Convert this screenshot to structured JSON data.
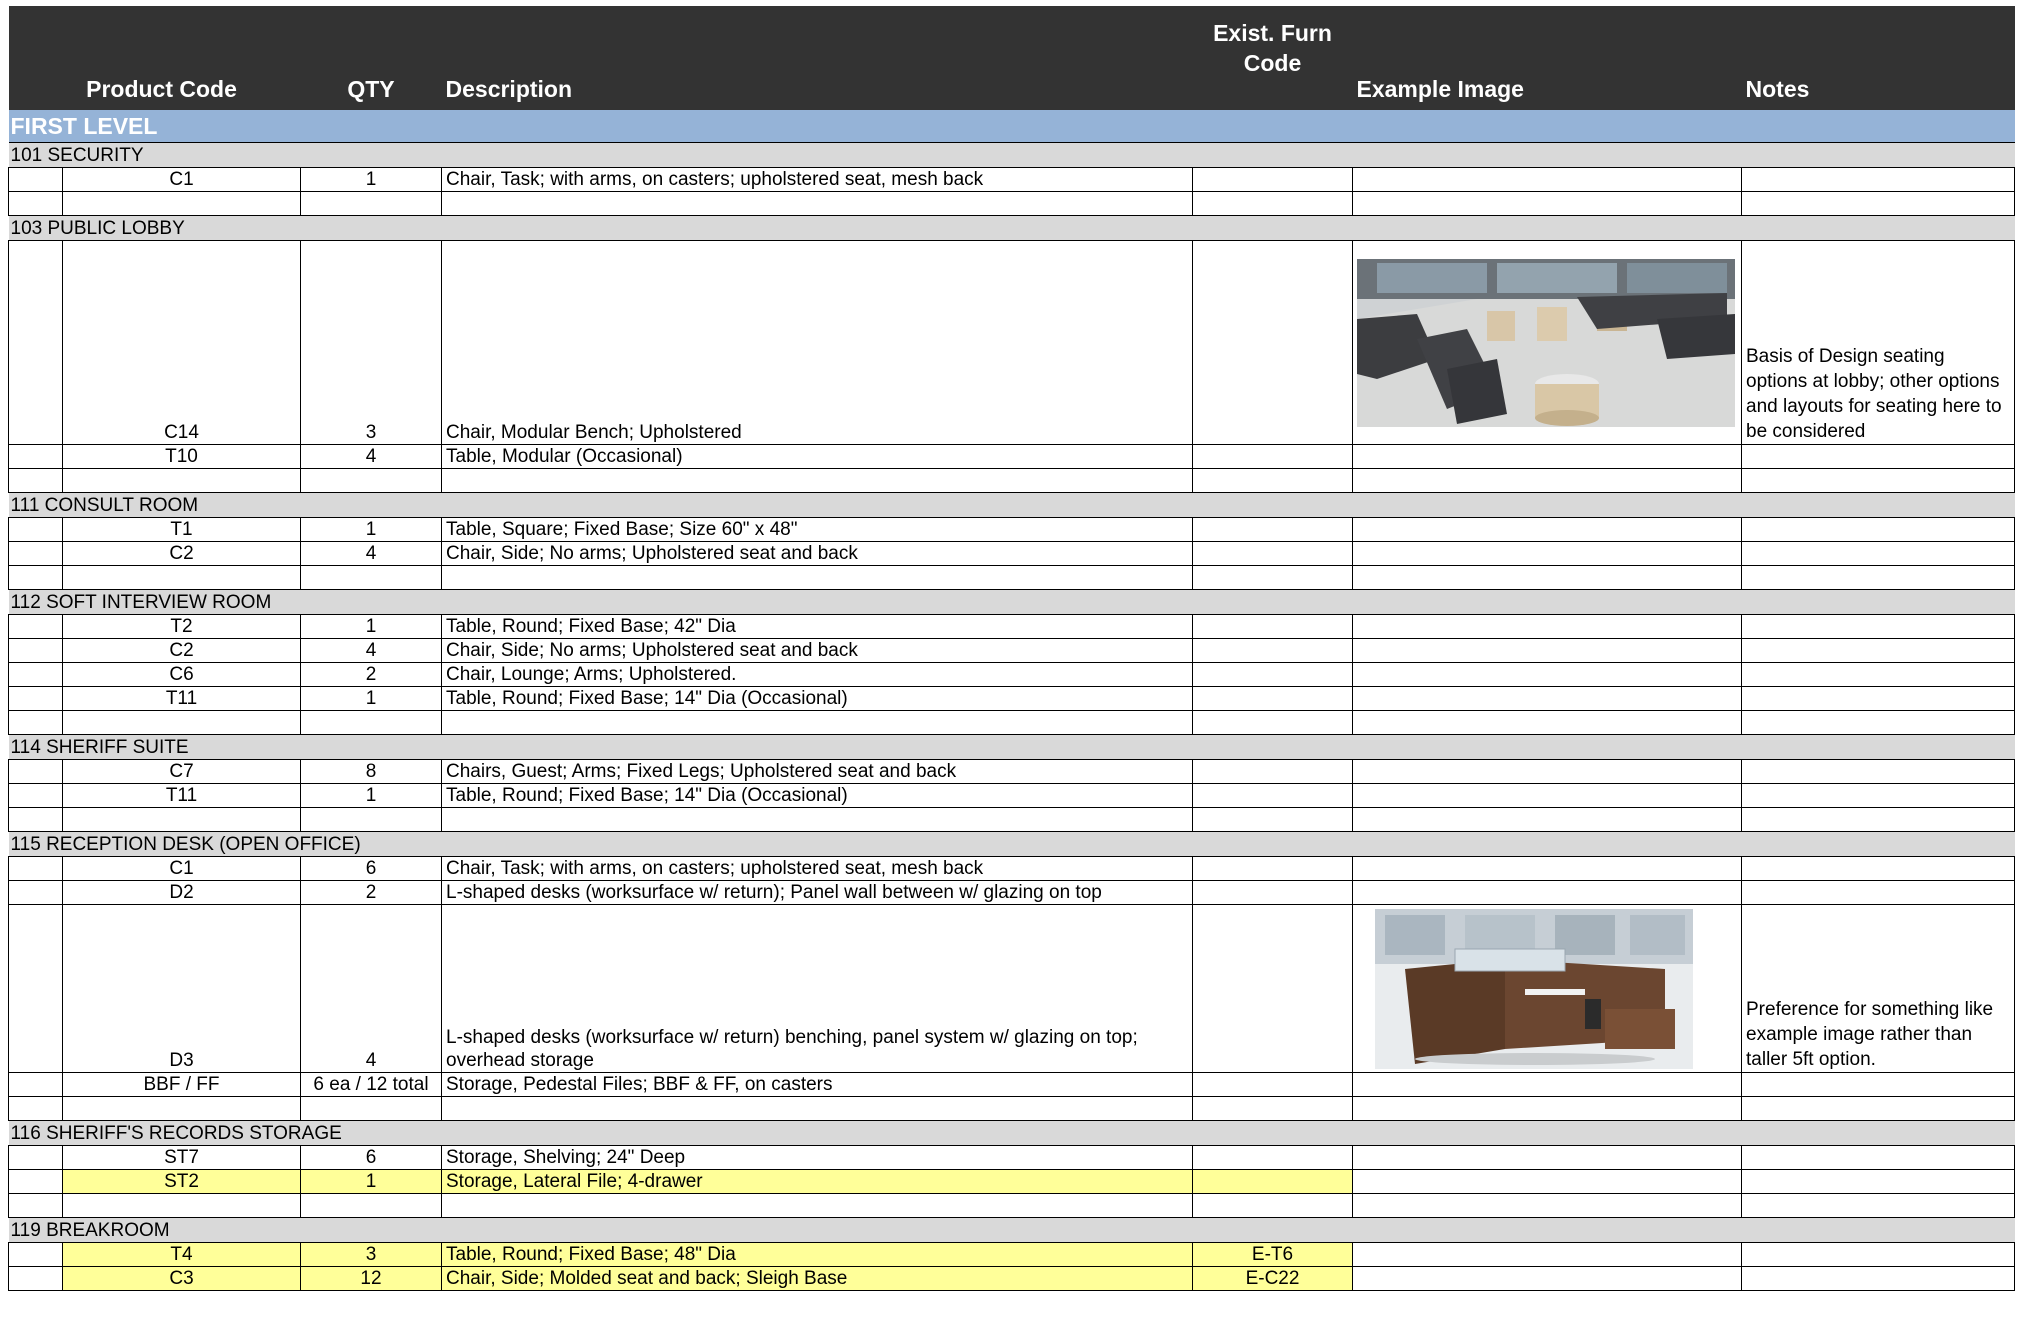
{
  "header": {
    "product_code": "Product Code",
    "qty": "QTY",
    "description": "Description",
    "exist_furn_code": "Exist. Furn Code",
    "example_image": "Example Image",
    "notes": "Notes"
  },
  "level": "FIRST LEVEL",
  "rooms": [
    {
      "name": "101 SECURITY",
      "items": [
        {
          "code": "C1",
          "qty": "1",
          "desc": "Chair, Task; with arms, on casters; upholstered seat, mesh back",
          "exist": "",
          "notes": ""
        }
      ]
    },
    {
      "name": "103 PUBLIC LOBBY",
      "items": [
        {
          "code": "C14",
          "qty": "3",
          "desc": "Chair, Modular Bench; Upholstered",
          "exist": "",
          "notes": "Basis of Design seating options at lobby; other options and layouts for seating here to be considered",
          "image": "lobby-seating-image"
        },
        {
          "code": "T10",
          "qty": "4",
          "desc": "Table, Modular (Occasional)",
          "exist": "",
          "notes": ""
        }
      ]
    },
    {
      "name": "111 CONSULT ROOM",
      "items": [
        {
          "code": "T1",
          "qty": "1",
          "desc": "Table, Square; Fixed Base; Size 60\" x 48\"",
          "exist": "",
          "notes": ""
        },
        {
          "code": "C2",
          "qty": "4",
          "desc": "Chair, Side; No arms; Upholstered seat and back",
          "exist": "",
          "notes": ""
        }
      ]
    },
    {
      "name": "112 SOFT INTERVIEW ROOM",
      "items": [
        {
          "code": "T2",
          "qty": "1",
          "desc": "Table, Round; Fixed Base; 42\" Dia",
          "exist": "",
          "notes": ""
        },
        {
          "code": "C2",
          "qty": "4",
          "desc": "Chair, Side; No arms; Upholstered seat and back",
          "exist": "",
          "notes": ""
        },
        {
          "code": "C6",
          "qty": "2",
          "desc": "Chair, Lounge; Arms; Upholstered.",
          "exist": "",
          "notes": ""
        },
        {
          "code": "T11",
          "qty": "1",
          "desc": "Table, Round; Fixed Base; 14\" Dia (Occasional)",
          "exist": "",
          "notes": ""
        }
      ]
    },
    {
      "name": "114 SHERIFF SUITE",
      "items": [
        {
          "code": "C7",
          "qty": "8",
          "desc": "Chairs, Guest; Arms; Fixed Legs; Upholstered seat and back",
          "exist": "",
          "notes": ""
        },
        {
          "code": "T11",
          "qty": "1",
          "desc": "Table, Round; Fixed Base; 14\" Dia (Occasional)",
          "exist": "",
          "notes": ""
        }
      ]
    },
    {
      "name": "115 RECEPTION DESK (OPEN OFFICE)",
      "items": [
        {
          "code": "C1",
          "qty": "6",
          "desc": "Chair, Task; with arms, on casters; upholstered seat, mesh back",
          "exist": "",
          "notes": ""
        },
        {
          "code": "D2",
          "qty": "2",
          "desc": "L-shaped desks (worksurface w/ return); Panel wall between w/ glazing on top",
          "exist": "",
          "notes": ""
        },
        {
          "code": "D3",
          "qty": "4",
          "desc": "L-shaped desks (worksurface w/ return) benching, panel system w/ glazing on top; overhead storage",
          "exist": "",
          "notes": "Preference for something like example image rather than taller 5ft option.",
          "image": "desk-workstation-image"
        },
        {
          "code": "BBF / FF",
          "qty": "6 ea / 12 total",
          "desc": "Storage, Pedestal Files; BBF & FF, on casters",
          "exist": "",
          "notes": ""
        }
      ]
    },
    {
      "name": "116 SHERIFF'S RECORDS STORAGE",
      "items": [
        {
          "code": "ST7",
          "qty": "6",
          "desc": "Storage, Shelving; 24\" Deep",
          "exist": "",
          "notes": ""
        },
        {
          "code": "ST2",
          "qty": "1",
          "desc": "Storage, Lateral File; 4-drawer",
          "exist": "",
          "notes": "",
          "highlight": true
        }
      ]
    },
    {
      "name": "119 BREAKROOM",
      "items": [
        {
          "code": "T4",
          "qty": "3",
          "desc": "Table, Round; Fixed Base; 48\" Dia",
          "exist": "E-T6",
          "notes": "",
          "highlight": true
        },
        {
          "code": "C3",
          "qty": "12",
          "desc": "Chair, Side; Molded seat and back; Sleigh Base",
          "exist": "E-C22",
          "notes": "",
          "highlight": true
        }
      ]
    }
  ],
  "colors": {
    "header_bg": "#333333",
    "level_bg": "#95b3d7",
    "room_bg": "#d9d9d9",
    "highlight": "#ffff99"
  }
}
